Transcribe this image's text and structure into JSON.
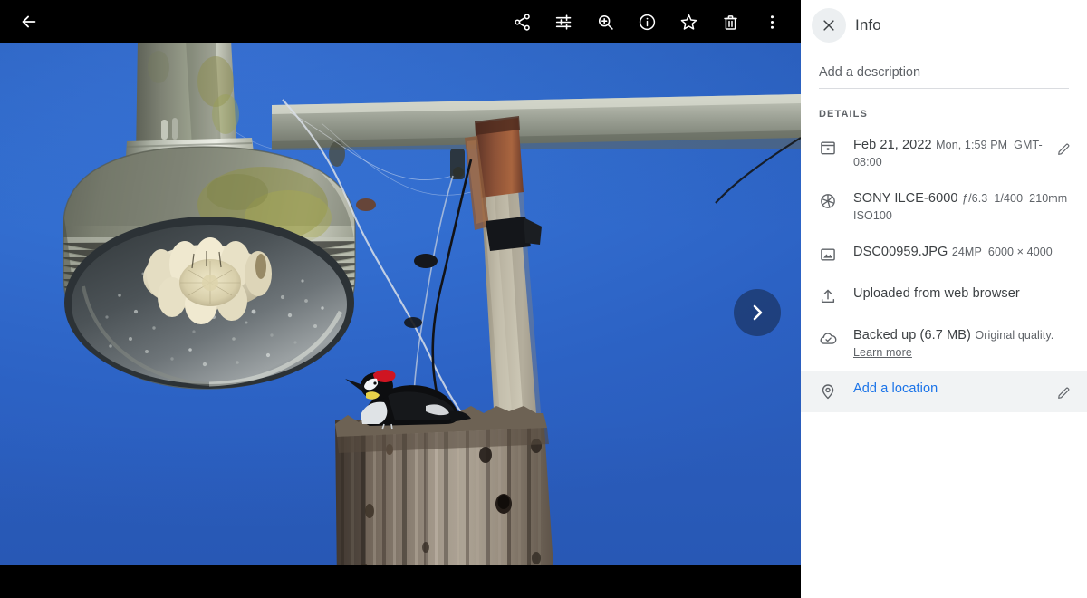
{
  "toolbar": {
    "back_label": "Back",
    "actions": [
      {
        "name": "share-icon",
        "label": "Share"
      },
      {
        "name": "tune-icon",
        "label": "Edit"
      },
      {
        "name": "zoom-in-icon",
        "label": "Zoom in"
      },
      {
        "name": "info-icon",
        "label": "Info"
      },
      {
        "name": "star-icon",
        "label": "Favorite"
      },
      {
        "name": "delete-icon",
        "label": "Delete"
      },
      {
        "name": "more-vert-icon",
        "label": "More options"
      }
    ]
  },
  "viewer": {
    "next_label": "Next photo",
    "photo_alt": "Acorn woodpecker perched on a weathered wooden utility pole beside a vintage streetlamp against a deep blue sky"
  },
  "panel": {
    "close_label": "Close",
    "title": "Info",
    "description": {
      "value": "",
      "placeholder": "Add a description"
    },
    "details_label": "DETAILS",
    "rows": [
      {
        "icon": "calendar-icon",
        "primary": "Feb 21, 2022",
        "secondary_parts": [
          "Mon, 1:59 PM",
          "GMT-08:00"
        ],
        "editable": true,
        "edit_label": "Edit date and time"
      },
      {
        "icon": "aperture-icon",
        "primary": "SONY ILCE-6000",
        "secondary_parts": [
          "ƒ/6.3",
          "1/400",
          "210mm",
          "ISO100"
        ],
        "editable": false
      },
      {
        "icon": "image-icon",
        "primary": "DSC00959.JPG",
        "secondary_parts": [
          "24MP",
          "6000 × 4000"
        ],
        "editable": false
      },
      {
        "icon": "upload-icon",
        "primary": "Uploaded from web browser",
        "secondary_parts": [],
        "editable": false
      },
      {
        "icon": "cloud-done-icon",
        "primary": "Backed up (6.7 MB)",
        "secondary_prefix": "Original quality.",
        "secondary_link": "Learn more",
        "secondary_parts": [],
        "editable": false
      },
      {
        "icon": "location-pin-icon",
        "primary": "Add a location",
        "secondary_parts": [],
        "editable": true,
        "edit_label": "Edit location",
        "is_link": true,
        "highlighted": true
      }
    ]
  },
  "colors": {
    "accent_blue": "#1a73e8",
    "text_primary": "#3c4043",
    "text_secondary": "#5f6368",
    "toolbar_bg": "#000000",
    "panel_bg": "#ffffff",
    "row_highlight": "#f1f3f4",
    "sky_blue": "#3470d2"
  }
}
